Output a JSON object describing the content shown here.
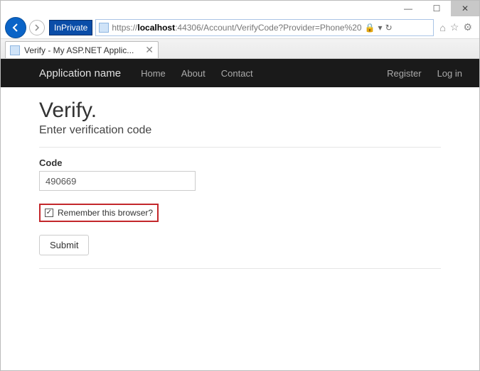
{
  "window": {
    "minimize": "—",
    "maximize": "☐",
    "close": "✕"
  },
  "browser": {
    "inprivate_label": "InPrivate",
    "url_scheme": "https://",
    "url_host": "localhost",
    "url_path": ":44306/Account/VerifyCode?Provider=Phone%20",
    "stop_icon": "✕",
    "refresh_icon": "↻",
    "dropdown_icon": "▾",
    "lock_icon": "🔒",
    "home_icon": "⌂",
    "star_icon": "☆",
    "gear_icon": "⚙"
  },
  "tab": {
    "title": "Verify - My ASP.NET Applic..."
  },
  "navbar": {
    "brand": "Application name",
    "home": "Home",
    "about": "About",
    "contact": "Contact",
    "register": "Register",
    "login": "Log in"
  },
  "page": {
    "heading": "Verify.",
    "subheading": "Enter verification code",
    "code_label": "Code",
    "code_value": "490669",
    "remember_label": "Remember this browser?",
    "remember_checked": "✓",
    "submit_label": "Submit"
  }
}
